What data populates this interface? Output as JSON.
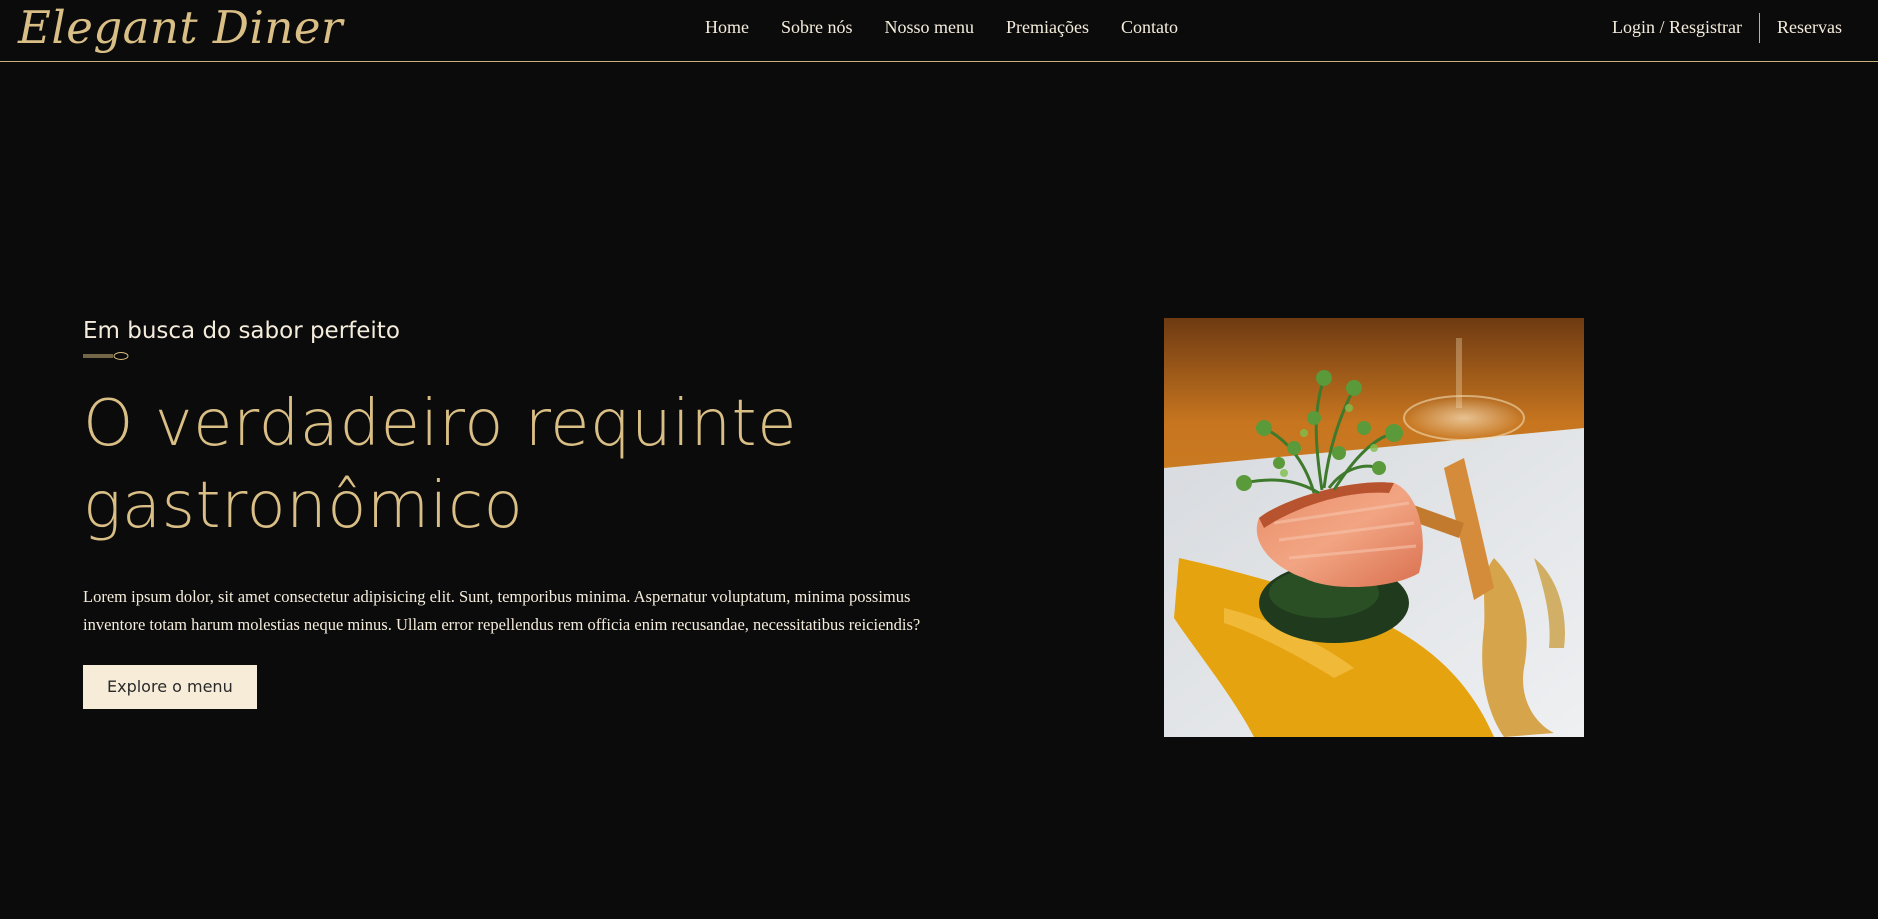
{
  "header": {
    "logo": "Elegant Diner",
    "nav": [
      "Home",
      "Sobre nós",
      "Nosso menu",
      "Premiações",
      "Contato"
    ],
    "login": "Login / Resgistrar",
    "reservations": "Reservas"
  },
  "hero": {
    "subtitle": "Em busca do sabor perfeito",
    "headline": "O verdadeiro requinte gastronômico",
    "body": "Lorem ipsum dolor, sit amet consectetur adipisicing elit. Sunt, temporibus minima. Aspernatur voluptatum, minima possimus inventore totam harum molestias neque minus. Ullam error repellendus rem officia enim recusandae, necessitatibus reiciendis?",
    "cta": "Explore o menu"
  },
  "colors": {
    "background": "#0b0b0b",
    "gold": "#d9bf86",
    "cream": "#f6ecd8",
    "text": "#f4ecdc"
  },
  "image": {
    "subject": "salmon-dish-icon"
  }
}
